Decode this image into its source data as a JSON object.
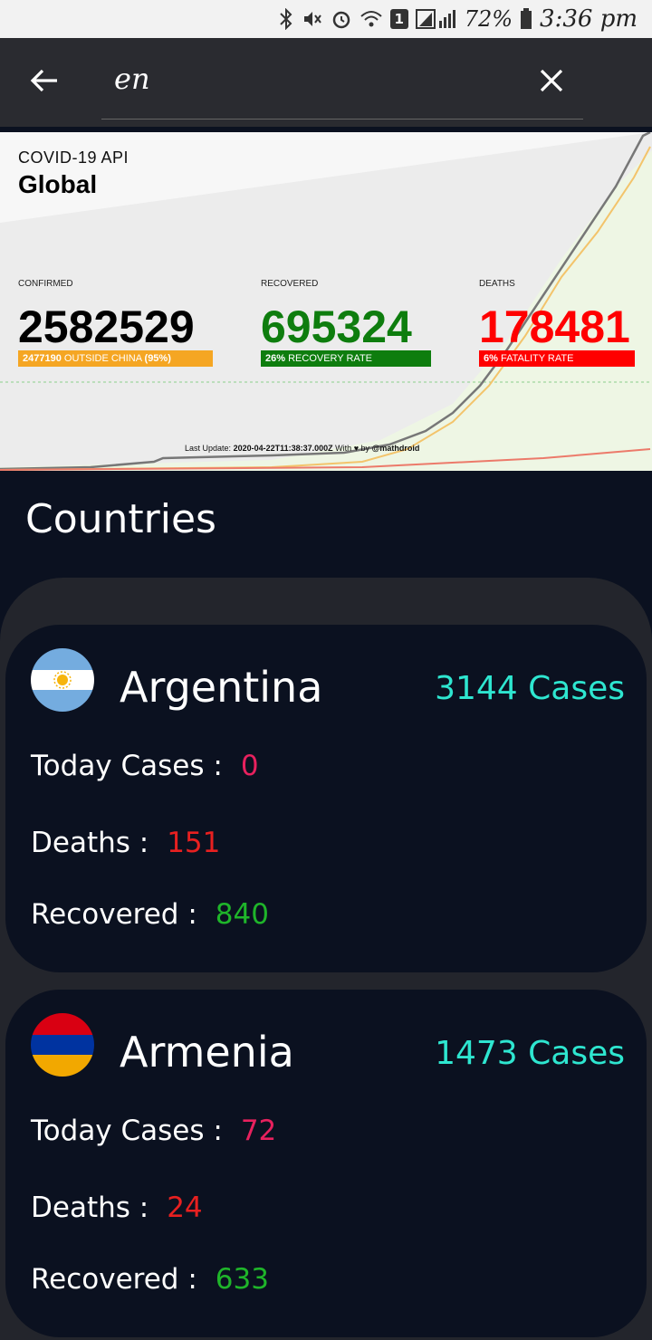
{
  "status_bar": {
    "battery": "72%",
    "time": "3:36 pm",
    "sim": "1"
  },
  "search": {
    "query": "en"
  },
  "banner": {
    "api_label": "COVID-19 API",
    "scope": "Global",
    "confirmed_label": "CONFIRMED",
    "confirmed": "2582529",
    "confirmed_tag_bold": "2477190",
    "confirmed_tag": "OUTSIDE CHINA",
    "confirmed_tag_pct": "(95%)",
    "recovered_label": "RECOVERED",
    "recovered": "695324",
    "recovered_tag_bold": "26%",
    "recovered_tag": "RECOVERY RATE",
    "deaths_label": "DEATHS",
    "deaths": "178481",
    "deaths_tag_bold": "6%",
    "deaths_tag": "FATALITY RATE",
    "update_prefix": "Last Update:",
    "update_time": "2020-04-22T11:38:37.000Z",
    "update_with": "With",
    "update_by": "by",
    "update_author": "@mathdroid",
    "colors": {
      "confirmed_tag": "#f5a623",
      "recovered": "#0e7d0e",
      "deaths": "#ff0000"
    }
  },
  "countries_title": "Countries",
  "countries": [
    {
      "name": "Argentina",
      "flag_icon": "argentina-flag-icon",
      "cases": "3144 Cases",
      "today_label": "Today Cases :",
      "today": "0",
      "deaths_label": "Deaths :",
      "deaths": "151",
      "recovered_label": "Recovered :",
      "recovered": "840"
    },
    {
      "name": "Armenia",
      "flag_icon": "armenia-flag-icon",
      "cases": "1473 Cases",
      "today_label": "Today Cases :",
      "today": "72",
      "deaths_label": "Deaths :",
      "deaths": "24",
      "recovered_label": "Recovered :",
      "recovered": "633"
    }
  ],
  "colors": {
    "cases": "#2ee6d0",
    "today": "#e8215e",
    "deaths": "#e82020",
    "recovered": "#1fb52a",
    "card_bg": "#0b1120",
    "panel_bg": "#23252c"
  }
}
